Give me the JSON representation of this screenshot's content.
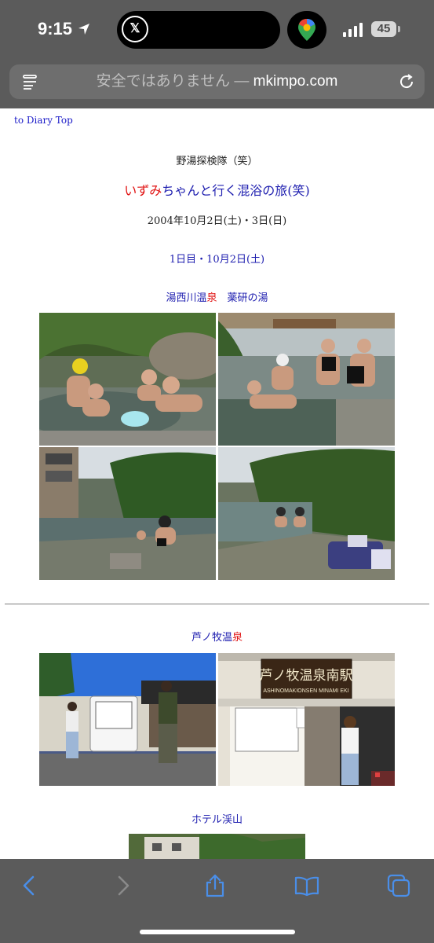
{
  "status": {
    "time": "9:15",
    "x_label": "𝕏",
    "battery": "45"
  },
  "address_bar": {
    "prefix": "安全ではありません — ",
    "domain": "mkimpo.com"
  },
  "page": {
    "top_link": "to Diary Top",
    "header": "野湯探検隊（笑）",
    "title_red": "いずみ",
    "title_rest": "ちゃんと行く混浴の旅(笑)",
    "dates": "2004年10月2日(土)・3日(日)",
    "day1": "1日目・10月2日(土)",
    "section1_a": "湯西川温",
    "section1_red": "泉",
    "section1_b": "　薬研の湯",
    "section2_a": "芦ノ牧温",
    "section2_red": "泉",
    "section3": "ホテル渓山",
    "sign_text": "芦ノ牧温泉南駅",
    "sign_sub": "ASHINOMAKIONSEN MINAMI EKI"
  },
  "colors": {
    "chrome": "#5b5b5b",
    "link_blue": "#2020b0",
    "accent_red": "#e01010",
    "ios_blue": "#4a8ee8"
  },
  "icons": [
    "location-arrow-icon",
    "x-app-icon",
    "maps-pin-icon",
    "signal-icon",
    "battery-icon",
    "reader-icon",
    "reload-icon",
    "back-icon",
    "forward-icon",
    "share-icon",
    "bookmarks-icon",
    "tabs-icon"
  ]
}
